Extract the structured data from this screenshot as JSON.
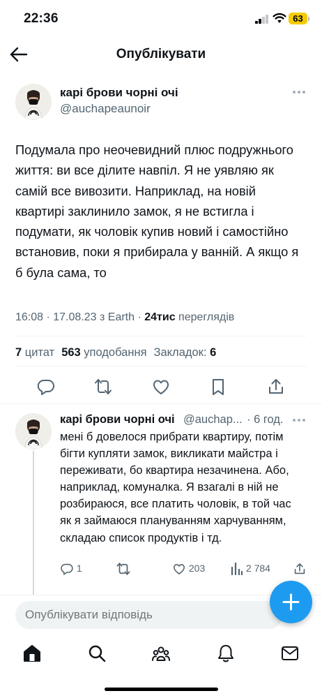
{
  "status_bar": {
    "time": "22:36",
    "battery": "63",
    "battery_color": "#f4cc00"
  },
  "nav": {
    "title": "Опублікувати",
    "back_icon": "arrow-left-icon"
  },
  "tweet": {
    "author": {
      "name": "карі брови чорні очі",
      "handle": "@auchapeaunoir"
    },
    "text": "Подумала про неочевидний плюс подружнього життя: ви все ділите навпіл. Я не уявляю як самій все вивозити. Наприклад, на новій квартирі заклинило замок, я не встигла і подумати, як чоловік купив новий і самостійно встановив, поки я прибирала у ванній. А якщо я б була сама, то",
    "meta": {
      "timestamp": "16:08 · 17.08.23 з Earth · ",
      "views_value": "24тис",
      "views_label": " переглядів"
    },
    "stats": {
      "quotes_value": "7",
      "quotes_label": " цитат",
      "likes_value": "563",
      "likes_label": " уподобання",
      "bookmarks_label": "Закладок: ",
      "bookmarks_value": "6"
    }
  },
  "reply": {
    "author": {
      "name": "карі брови чорні очі",
      "handle": "@auchap...",
      "time": "· 6 год."
    },
    "text": "мені б довелося прибрати квартиру, потім бігти купляти замок, викликати майстра і переживати, бо квартира незачинена. Або, наприклад, комуналка. Я взагалі в ній не розбираюся, все платить чоловік, в той час як я займаюся плануванням харчуванням, складаю список продуктів і тд.",
    "actions": {
      "replies": "1",
      "retweets": "",
      "likes": "203",
      "views": "2 784"
    }
  },
  "composer": {
    "placeholder": "Опублікувати відповідь"
  },
  "colors": {
    "accent": "#1d9bf0",
    "secondary_text": "#536471",
    "divider": "#eff3f4"
  }
}
